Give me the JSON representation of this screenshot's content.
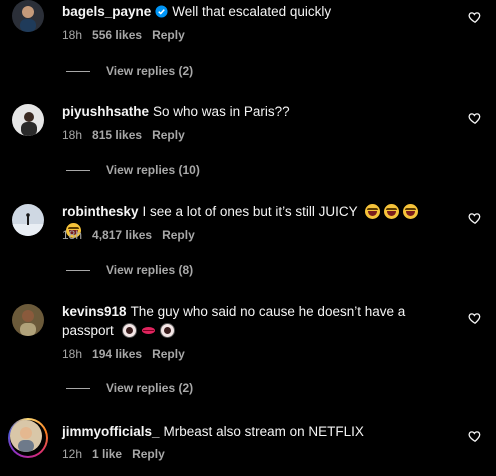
{
  "comments": [
    {
      "username": "bagels_payne",
      "verified": true,
      "text": "Well that escalated quickly",
      "time": "18h",
      "likes": "556 likes",
      "reply_label": "Reply",
      "view_replies": "View replies (2)"
    },
    {
      "username": "piyushhsathe",
      "verified": false,
      "text": "So who was in Paris??",
      "time": "18h",
      "likes": "815 likes",
      "reply_label": "Reply",
      "view_replies": "View replies (10)"
    },
    {
      "username": "robinthesky",
      "verified": false,
      "text": "I see a lot of ones but it’s still JUICY",
      "emojis": [
        "laughing-face",
        "laughing-face",
        "laughing-face",
        "laughing-face"
      ],
      "time": "18h",
      "likes": "4,817 likes",
      "reply_label": "Reply",
      "view_replies": "View replies (8)"
    },
    {
      "username": "kevins918",
      "verified": false,
      "text": "The guy who said no cause he doesn’t have a passport",
      "emojis": [
        "eye",
        "lips",
        "eye"
      ],
      "time": "18h",
      "likes": "194 likes",
      "reply_label": "Reply",
      "view_replies": "View replies (2)"
    },
    {
      "username": "jimmyofficials_",
      "verified": false,
      "story_ring": true,
      "text": "Mrbeast also stream on NETFLIX",
      "time": "12h",
      "likes": "1 like",
      "reply_label": "Reply"
    }
  ],
  "colors": {
    "background": "#000000",
    "primary_text": "#f5f5f5",
    "secondary_text": "#a8a8a8",
    "verified_badge": "#0095f6"
  }
}
